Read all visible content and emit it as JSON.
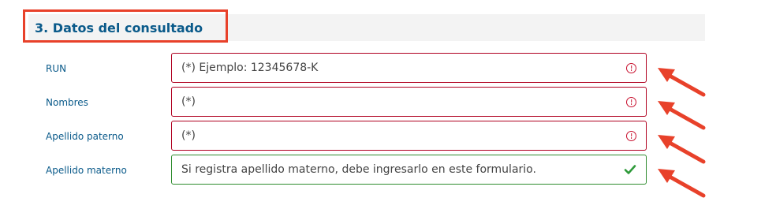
{
  "section": {
    "title": "3. Datos del consultado"
  },
  "fields": [
    {
      "label": "RUN",
      "value": "(*) Ejemplo: 12345678-K",
      "status": "error",
      "status_icon": "error-circle-icon"
    },
    {
      "label": "Nombres",
      "value": "(*)",
      "status": "error",
      "status_icon": "error-circle-icon"
    },
    {
      "label": "Apellido paterno",
      "value": "(*)",
      "status": "error",
      "status_icon": "error-circle-icon"
    },
    {
      "label": "Apellido materno",
      "value": "Si registra apellido materno, debe ingresarlo en este formulario.",
      "status": "valid",
      "status_icon": "check-icon"
    }
  ],
  "colors": {
    "accent_text": "#0a5a8a",
    "error_border": "#b00020",
    "error_icon": "#c8102e",
    "valid_border": "#2e8b2e",
    "annotation_red": "#e8412a",
    "section_bg": "#f3f3f3"
  }
}
